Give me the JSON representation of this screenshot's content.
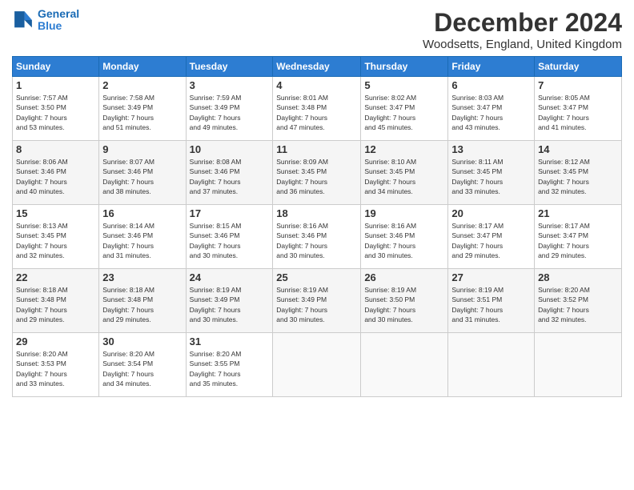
{
  "logo": {
    "line1": "General",
    "line2": "Blue"
  },
  "title": "December 2024",
  "subtitle": "Woodsetts, England, United Kingdom",
  "header_days": [
    "Sunday",
    "Monday",
    "Tuesday",
    "Wednesday",
    "Thursday",
    "Friday",
    "Saturday"
  ],
  "weeks": [
    [
      {
        "day": "1",
        "info": "Sunrise: 7:57 AM\nSunset: 3:50 PM\nDaylight: 7 hours\nand 53 minutes."
      },
      {
        "day": "2",
        "info": "Sunrise: 7:58 AM\nSunset: 3:49 PM\nDaylight: 7 hours\nand 51 minutes."
      },
      {
        "day": "3",
        "info": "Sunrise: 7:59 AM\nSunset: 3:49 PM\nDaylight: 7 hours\nand 49 minutes."
      },
      {
        "day": "4",
        "info": "Sunrise: 8:01 AM\nSunset: 3:48 PM\nDaylight: 7 hours\nand 47 minutes."
      },
      {
        "day": "5",
        "info": "Sunrise: 8:02 AM\nSunset: 3:47 PM\nDaylight: 7 hours\nand 45 minutes."
      },
      {
        "day": "6",
        "info": "Sunrise: 8:03 AM\nSunset: 3:47 PM\nDaylight: 7 hours\nand 43 minutes."
      },
      {
        "day": "7",
        "info": "Sunrise: 8:05 AM\nSunset: 3:47 PM\nDaylight: 7 hours\nand 41 minutes."
      }
    ],
    [
      {
        "day": "8",
        "info": "Sunrise: 8:06 AM\nSunset: 3:46 PM\nDaylight: 7 hours\nand 40 minutes."
      },
      {
        "day": "9",
        "info": "Sunrise: 8:07 AM\nSunset: 3:46 PM\nDaylight: 7 hours\nand 38 minutes."
      },
      {
        "day": "10",
        "info": "Sunrise: 8:08 AM\nSunset: 3:46 PM\nDaylight: 7 hours\nand 37 minutes."
      },
      {
        "day": "11",
        "info": "Sunrise: 8:09 AM\nSunset: 3:45 PM\nDaylight: 7 hours\nand 36 minutes."
      },
      {
        "day": "12",
        "info": "Sunrise: 8:10 AM\nSunset: 3:45 PM\nDaylight: 7 hours\nand 34 minutes."
      },
      {
        "day": "13",
        "info": "Sunrise: 8:11 AM\nSunset: 3:45 PM\nDaylight: 7 hours\nand 33 minutes."
      },
      {
        "day": "14",
        "info": "Sunrise: 8:12 AM\nSunset: 3:45 PM\nDaylight: 7 hours\nand 32 minutes."
      }
    ],
    [
      {
        "day": "15",
        "info": "Sunrise: 8:13 AM\nSunset: 3:45 PM\nDaylight: 7 hours\nand 32 minutes."
      },
      {
        "day": "16",
        "info": "Sunrise: 8:14 AM\nSunset: 3:46 PM\nDaylight: 7 hours\nand 31 minutes."
      },
      {
        "day": "17",
        "info": "Sunrise: 8:15 AM\nSunset: 3:46 PM\nDaylight: 7 hours\nand 30 minutes."
      },
      {
        "day": "18",
        "info": "Sunrise: 8:16 AM\nSunset: 3:46 PM\nDaylight: 7 hours\nand 30 minutes."
      },
      {
        "day": "19",
        "info": "Sunrise: 8:16 AM\nSunset: 3:46 PM\nDaylight: 7 hours\nand 30 minutes."
      },
      {
        "day": "20",
        "info": "Sunrise: 8:17 AM\nSunset: 3:47 PM\nDaylight: 7 hours\nand 29 minutes."
      },
      {
        "day": "21",
        "info": "Sunrise: 8:17 AM\nSunset: 3:47 PM\nDaylight: 7 hours\nand 29 minutes."
      }
    ],
    [
      {
        "day": "22",
        "info": "Sunrise: 8:18 AM\nSunset: 3:48 PM\nDaylight: 7 hours\nand 29 minutes."
      },
      {
        "day": "23",
        "info": "Sunrise: 8:18 AM\nSunset: 3:48 PM\nDaylight: 7 hours\nand 29 minutes."
      },
      {
        "day": "24",
        "info": "Sunrise: 8:19 AM\nSunset: 3:49 PM\nDaylight: 7 hours\nand 30 minutes."
      },
      {
        "day": "25",
        "info": "Sunrise: 8:19 AM\nSunset: 3:49 PM\nDaylight: 7 hours\nand 30 minutes."
      },
      {
        "day": "26",
        "info": "Sunrise: 8:19 AM\nSunset: 3:50 PM\nDaylight: 7 hours\nand 30 minutes."
      },
      {
        "day": "27",
        "info": "Sunrise: 8:19 AM\nSunset: 3:51 PM\nDaylight: 7 hours\nand 31 minutes."
      },
      {
        "day": "28",
        "info": "Sunrise: 8:20 AM\nSunset: 3:52 PM\nDaylight: 7 hours\nand 32 minutes."
      }
    ],
    [
      {
        "day": "29",
        "info": "Sunrise: 8:20 AM\nSunset: 3:53 PM\nDaylight: 7 hours\nand 33 minutes."
      },
      {
        "day": "30",
        "info": "Sunrise: 8:20 AM\nSunset: 3:54 PM\nDaylight: 7 hours\nand 34 minutes."
      },
      {
        "day": "31",
        "info": "Sunrise: 8:20 AM\nSunset: 3:55 PM\nDaylight: 7 hours\nand 35 minutes."
      },
      null,
      null,
      null,
      null
    ]
  ]
}
